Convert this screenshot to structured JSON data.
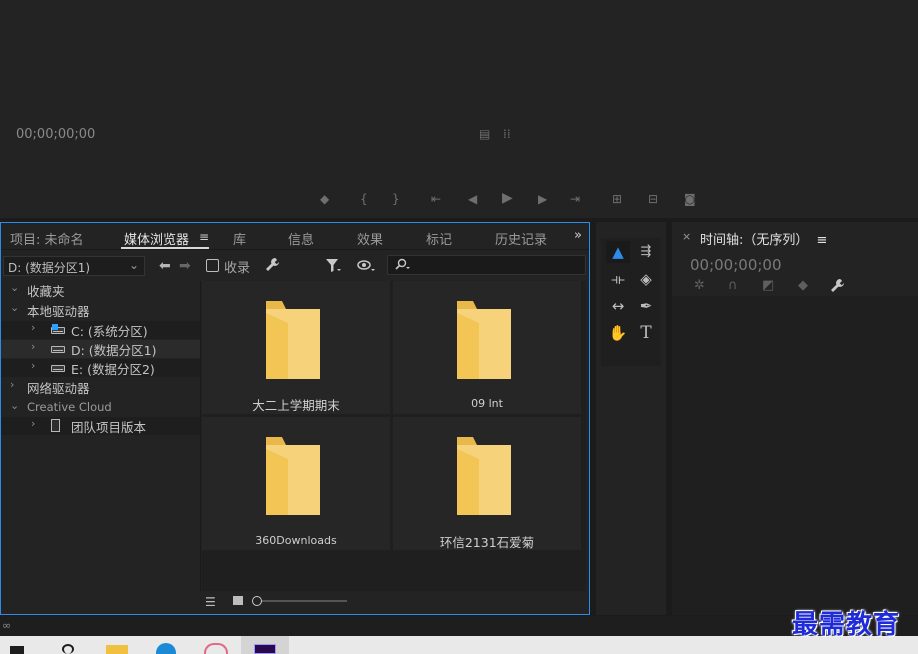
{
  "monitor": {
    "timecode": "00;00;00;00"
  },
  "tabs": [
    {
      "label": "项目: 未命名"
    },
    {
      "label": "媒体浏览器"
    },
    {
      "label": "库"
    },
    {
      "label": "信息"
    },
    {
      "label": "效果"
    },
    {
      "label": "标记"
    },
    {
      "label": "历史记录"
    }
  ],
  "media_browser": {
    "drive_selected": "D: (数据分区1)",
    "ingest_label": "收录",
    "search_placeholder": "",
    "tree": [
      {
        "label": "收藏夹"
      },
      {
        "label": "本地驱动器"
      },
      {
        "label": "C: (系统分区)"
      },
      {
        "label": "D: (数据分区1)"
      },
      {
        "label": "E: (数据分区2)"
      },
      {
        "label": "网络驱动器"
      },
      {
        "label": "Creative Cloud"
      },
      {
        "label": "团队项目版本"
      }
    ],
    "items": [
      {
        "name": "大二上学期期末"
      },
      {
        "name": "09 lnt"
      },
      {
        "name": "360Downloads"
      },
      {
        "name": "环信2131石爱菊"
      }
    ],
    "zoom_level": 0
  },
  "timeline": {
    "title": "时间轴:（无序列）",
    "timecode": "00;00;00;00"
  },
  "watermark": {
    "text": "最需教育"
  },
  "colors": {
    "accent": "#2d8ceb",
    "folder": "#f6d37a",
    "panel_bg": "#232323"
  },
  "icons": {
    "folder": "folder-icon",
    "wrench": "wrench-icon",
    "filter": "filter-icon",
    "eye": "eye-icon",
    "search": "search-icon"
  }
}
